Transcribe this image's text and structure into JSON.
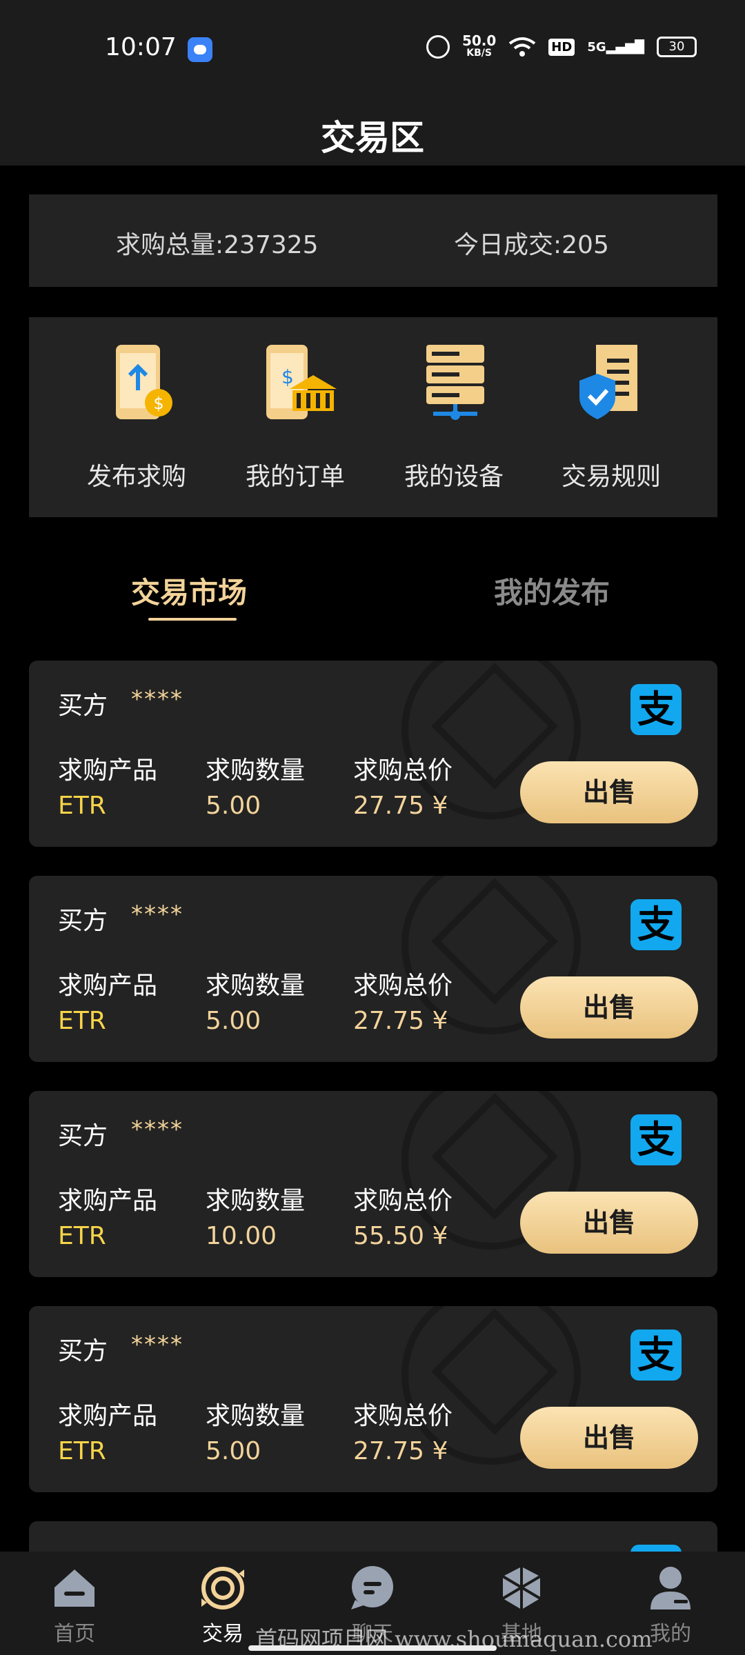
{
  "status_bar": {
    "time": "10:07",
    "net_speed_value": "50.0",
    "net_speed_unit": "KB/S",
    "hd": "HD",
    "signal": "5G",
    "battery": "30"
  },
  "header": {
    "title": "交易区"
  },
  "stats": {
    "total_label": "求购总量:",
    "total_value": "237325",
    "today_label": "今日成交:",
    "today_value": "205"
  },
  "quick_actions": [
    {
      "label": "发布求购",
      "icon": "phone-upload-icon"
    },
    {
      "label": "我的订单",
      "icon": "bank-orders-icon"
    },
    {
      "label": "我的设备",
      "icon": "server-devices-icon"
    },
    {
      "label": "交易规则",
      "icon": "document-shield-icon"
    }
  ],
  "tabs": [
    {
      "label": "交易市场",
      "active": true
    },
    {
      "label": "我的发布",
      "active": false
    }
  ],
  "labels": {
    "buyer": "买方",
    "product": "求购产品",
    "quantity": "求购数量",
    "total_price": "求购总价",
    "sell": "出售",
    "payment_icon": "支"
  },
  "orders": [
    {
      "buyer": "****",
      "product": "ETR",
      "quantity": "5.00",
      "price": "27.75 ¥"
    },
    {
      "buyer": "****",
      "product": "ETR",
      "quantity": "5.00",
      "price": "27.75 ¥"
    },
    {
      "buyer": "****",
      "product": "ETR",
      "quantity": "10.00",
      "price": "55.50 ¥"
    },
    {
      "buyer": "****",
      "product": "ETR",
      "quantity": "5.00",
      "price": "27.75 ¥"
    }
  ],
  "bottom_nav": [
    {
      "label": "首页",
      "icon": "home-icon",
      "active": false
    },
    {
      "label": "交易",
      "icon": "trade-icon",
      "active": true
    },
    {
      "label": "聊天",
      "icon": "chat-icon",
      "active": false
    },
    {
      "label": "基地",
      "icon": "cube-icon",
      "active": false
    },
    {
      "label": "我的",
      "icon": "profile-icon",
      "active": false
    }
  ],
  "watermark": "首码网项目网 www.shoumaquan.com",
  "colors": {
    "accent": "#f3d39a",
    "product": "#f7d44a",
    "alipay": "#12a8f0",
    "card": "#232323"
  }
}
